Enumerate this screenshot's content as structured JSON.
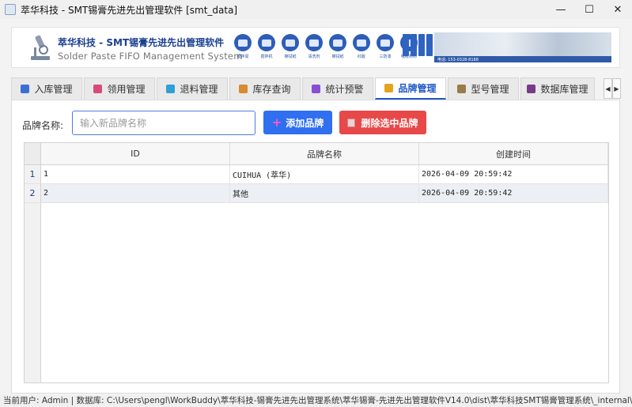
{
  "window": {
    "title": "萃华科技 - SMT锡膏先进先出管理软件 [smt_data]",
    "controls": {
      "minimize": "—",
      "maximize": "☐",
      "close": "✕"
    }
  },
  "header": {
    "title": "萃华科技 - SMT锡膏先进先出管理软件",
    "subtitle": "Solder Paste FIFO Management System",
    "banner_icons": [
      "搅拌膏",
      "搅拌机",
      "擦拭纸",
      "清洗剂",
      "擦拭纸",
      "红胶",
      "三防漆",
      "吸收材料"
    ],
    "banner_contact": "电话: 153-0328-8188"
  },
  "tabs": [
    {
      "label": "入库管理",
      "icon": "inbound-icon",
      "color": "#3b6fd6"
    },
    {
      "label": "领用管理",
      "icon": "issue-icon",
      "color": "#d64c78"
    },
    {
      "label": "退料管理",
      "icon": "return-icon",
      "color": "#2f9fd8"
    },
    {
      "label": "库存查询",
      "icon": "box-icon",
      "color": "#d88a2f"
    },
    {
      "label": "统计预警",
      "icon": "chart-icon",
      "color": "#8a4fd0"
    },
    {
      "label": "品牌管理",
      "icon": "tag-icon",
      "color": "#e3a51c"
    },
    {
      "label": "型号管理",
      "icon": "model-icon",
      "color": "#9a7a4a"
    },
    {
      "label": "数据库管理",
      "icon": "save-icon",
      "color": "#7a3a8a"
    }
  ],
  "tab_scroll": {
    "left": "◀",
    "right": "▶"
  },
  "brand_form": {
    "label": "品牌名称:",
    "placeholder": "输入新品牌名称",
    "add_label": "添加品牌",
    "delete_label": "删除选中品牌"
  },
  "table": {
    "columns": [
      "ID",
      "品牌名称",
      "创建时间"
    ],
    "rows": [
      {
        "rownum": "1",
        "id": "1",
        "name": "CUIHUA (萃华)",
        "created": "2026-04-09 20:59:42"
      },
      {
        "rownum": "2",
        "id": "2",
        "name": "其他",
        "created": "2026-04-09 20:59:42"
      }
    ]
  },
  "status": {
    "text": "当前用户: Admin | 数据库: C:\\Users\\pengl\\WorkBuddy\\萃华科技-锡膏先进先出管理系统\\萃华锡膏-先进先出管理软件V14.0\\dist\\萃华科技SMT锡膏管理系统\\_internal\\smt_data.db"
  }
}
